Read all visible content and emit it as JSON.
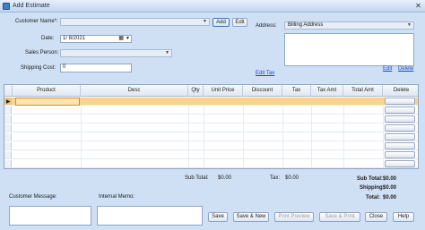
{
  "window": {
    "title": "Add Estimate",
    "close_glyph": "✕"
  },
  "customer": {
    "label": "Customer Name*:",
    "value": "",
    "add_label": "Add",
    "edit_label": "Edit"
  },
  "date": {
    "label": "Date:",
    "value": "1/ 8/2021"
  },
  "sales_person": {
    "label": "Sales Person:",
    "value": ""
  },
  "shipping_cost": {
    "label": "Shipping Cost:",
    "value": "0"
  },
  "address": {
    "label": "Address:",
    "type_value": "Billing Address",
    "text": "",
    "edit_label": "Edit",
    "delete_label": "Delete"
  },
  "edit_tax_label": "Edit Tax",
  "grid": {
    "columns": [
      "Product",
      "Desc",
      "Qty",
      "Unit Price",
      "Discount",
      "Tax",
      "Tax Amt",
      "Total Amt",
      "Delete"
    ],
    "rows": 8
  },
  "totals": {
    "sub_total_label": "Sub Total:",
    "sub_total_value": "$0.00",
    "tax_label": "Tax:",
    "tax_value": "$0.00",
    "right_sub_total_label": "Sub Total:",
    "right_sub_total_value": "$0.00",
    "shipping_label": "Shipping:",
    "shipping_value": "$0.00",
    "total_label": "Total:",
    "total_value": "$0.00"
  },
  "customer_message": {
    "label": "Customer Message:",
    "value": ""
  },
  "internal_memo": {
    "label": "Internal Memo:",
    "value": ""
  },
  "buttons": {
    "save": "Save",
    "save_new": "Save & New",
    "print_preview": "Print Preview",
    "save_print": "Save & Print",
    "close": "Close",
    "help": "Help"
  }
}
